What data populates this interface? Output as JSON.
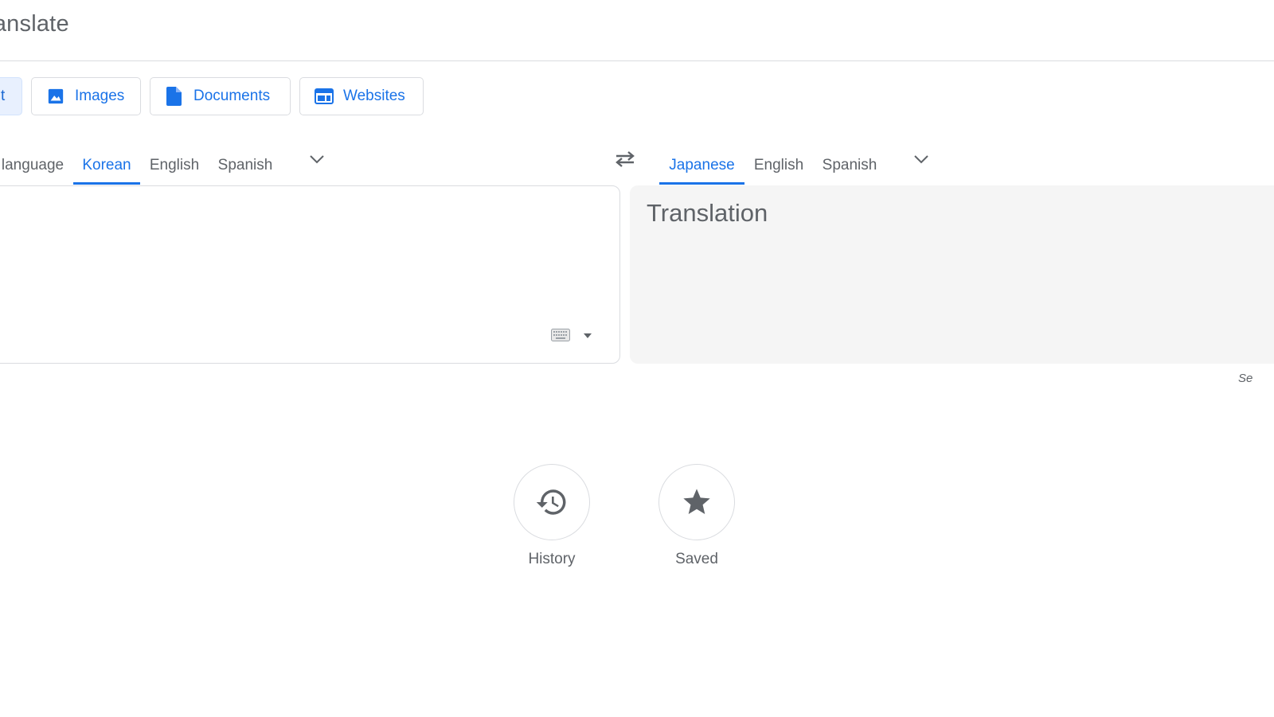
{
  "header": {
    "title": "ranslate"
  },
  "modes": {
    "text_label": "t",
    "images_label": "Images",
    "documents_label": "Documents",
    "websites_label": "Websites"
  },
  "source_languages": {
    "detect_label": "language",
    "tabs": [
      "Korean",
      "English",
      "Spanish"
    ],
    "active": "Korean"
  },
  "target_languages": {
    "tabs": [
      "Japanese",
      "English",
      "Spanish"
    ],
    "active": "Japanese"
  },
  "source_input": {
    "value": ""
  },
  "target_output": {
    "placeholder": "Translation"
  },
  "feedback": {
    "label": "Se"
  },
  "bottom_actions": {
    "history_label": "History",
    "saved_label": "Saved"
  },
  "colors": {
    "accent": "#1a73e8",
    "active_mode_bg": "#e8f0fe",
    "icon_gray": "#5f6368",
    "panel_bg": "#f5f5f5",
    "border": "#dadce0"
  },
  "icons": {
    "images": "image-icon",
    "documents": "document-icon",
    "websites": "website-icon",
    "swap": "swap-icon",
    "dropdown": "chevron-down-icon",
    "keyboard": "keyboard-icon",
    "history": "history-icon",
    "saved": "star-icon"
  }
}
